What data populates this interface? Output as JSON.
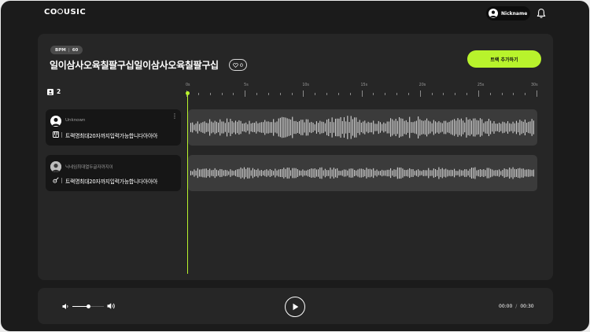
{
  "header": {
    "logo_left": "CO",
    "logo_right": "USIC",
    "nickname": "Nickname"
  },
  "project": {
    "bpm_label": "BPM",
    "bpm_value": "60",
    "title": "일이삼사오육칠팔구십일이삼사오육칠팔구십",
    "like_count": "0",
    "add_track_label": "트랙 추가하기",
    "track_count": "2"
  },
  "timeline": {
    "labels": [
      "0s",
      "5s",
      "10s",
      "15s",
      "20s",
      "25s",
      "30s"
    ],
    "duration_seconds": 30,
    "playhead_seconds": 0
  },
  "tracks": [
    {
      "user_name": "Unknown",
      "instrument_icon": "piano-icon",
      "track_name": "트랙명최대20자까지입력가능합니다아아아"
    },
    {
      "user_name": "닉네임최대열두글자까지이",
      "instrument_icon": "guitar-icon",
      "track_name": "트랙명최대20자까지입력가능합니다아아아"
    }
  ],
  "player": {
    "volume": 0.5,
    "current_time": "00:00",
    "total_time": "00:30"
  },
  "colors": {
    "accent": "#b8f32c",
    "background": "#1b1b1b",
    "panel": "#262626",
    "track_card": "#161616",
    "wave_box": "#3b3b3b",
    "waveform": "#d4d4d4"
  }
}
